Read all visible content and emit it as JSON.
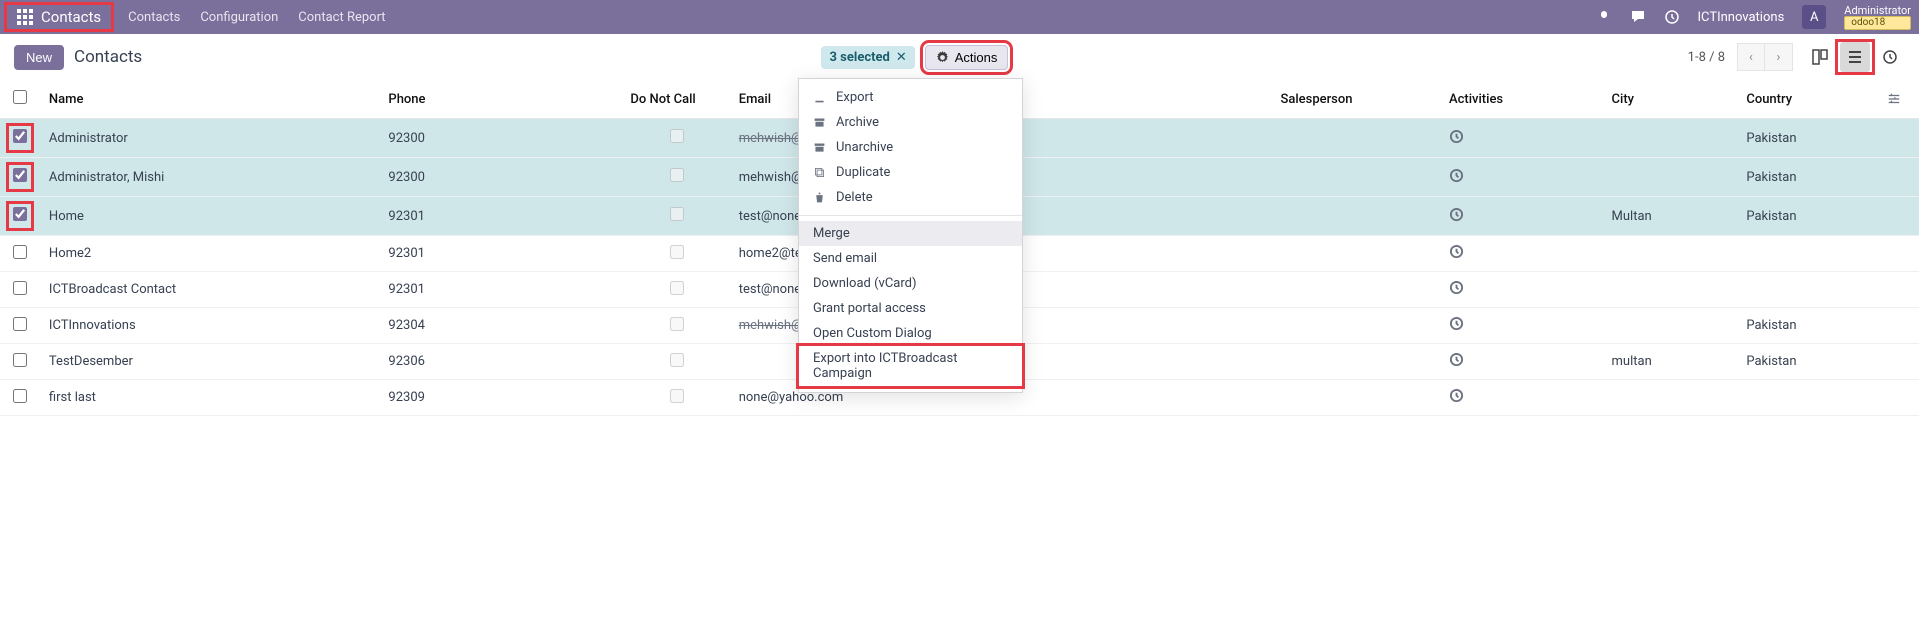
{
  "topbar": {
    "app_name": "Contacts",
    "nav": [
      "Contacts",
      "Configuration",
      "Contact Report"
    ],
    "company": "ICTInnovations",
    "avatar_letter": "A",
    "user_name": "Administrator",
    "db_badge": "odoo18"
  },
  "cp": {
    "new_label": "New",
    "breadcrumb": "Contacts",
    "selected_text": "3 selected",
    "actions_label": "Actions",
    "pager": "1-8 / 8"
  },
  "columns": {
    "name": "Name",
    "phone": "Phone",
    "dnc": "Do Not Call",
    "email": "Email",
    "salesperson": "Salesperson",
    "activities": "Activities",
    "city": "City",
    "country": "Country"
  },
  "rows": [
    {
      "sel": true,
      "name": "Administrator",
      "phone": "92300",
      "email": "mehwish@ictinnovations.com",
      "strike": true,
      "city": "",
      "country": "Pakistan"
    },
    {
      "sel": true,
      "name": "Administrator, Mishi",
      "phone": "92300",
      "email": "mehwish@gmail.com",
      "strike": false,
      "city": "",
      "country": "Pakistan"
    },
    {
      "sel": true,
      "name": "Home",
      "phone": "92301",
      "email": "test@none.com",
      "strike": false,
      "city": "Multan",
      "country": "Pakistan"
    },
    {
      "sel": false,
      "name": "Home2",
      "phone": "92301",
      "email": "home2@test.com",
      "strike": false,
      "city": "",
      "country": ""
    },
    {
      "sel": false,
      "name": "ICTBroadcast Contact",
      "phone": "92301",
      "email": "test@none.com",
      "strike": false,
      "city": "",
      "country": ""
    },
    {
      "sel": false,
      "name": "ICTInnovations",
      "phone": "92304",
      "email": "mehwish@ictinnovations.com",
      "strike": true,
      "city": "",
      "country": "Pakistan"
    },
    {
      "sel": false,
      "name": "TestDesember",
      "phone": "92306",
      "email": "",
      "strike": false,
      "city": "multan",
      "country": "Pakistan"
    },
    {
      "sel": false,
      "name": "first last",
      "phone": "92309",
      "email": "none@yahoo.com",
      "strike": false,
      "city": "",
      "country": ""
    }
  ],
  "dropdown": {
    "items1": [
      {
        "icon": "export",
        "label": "Export"
      },
      {
        "icon": "archive",
        "label": "Archive"
      },
      {
        "icon": "unarchive",
        "label": "Unarchive"
      },
      {
        "icon": "duplicate",
        "label": "Duplicate"
      },
      {
        "icon": "delete",
        "label": "Delete"
      }
    ],
    "items2": [
      {
        "label": "Merge",
        "hover": true
      },
      {
        "label": "Send email"
      },
      {
        "label": "Download (vCard)"
      },
      {
        "label": "Grant portal access"
      },
      {
        "label": "Open Custom Dialog"
      },
      {
        "label": "Export into ICTBroadcast Campaign",
        "red": true
      }
    ]
  }
}
